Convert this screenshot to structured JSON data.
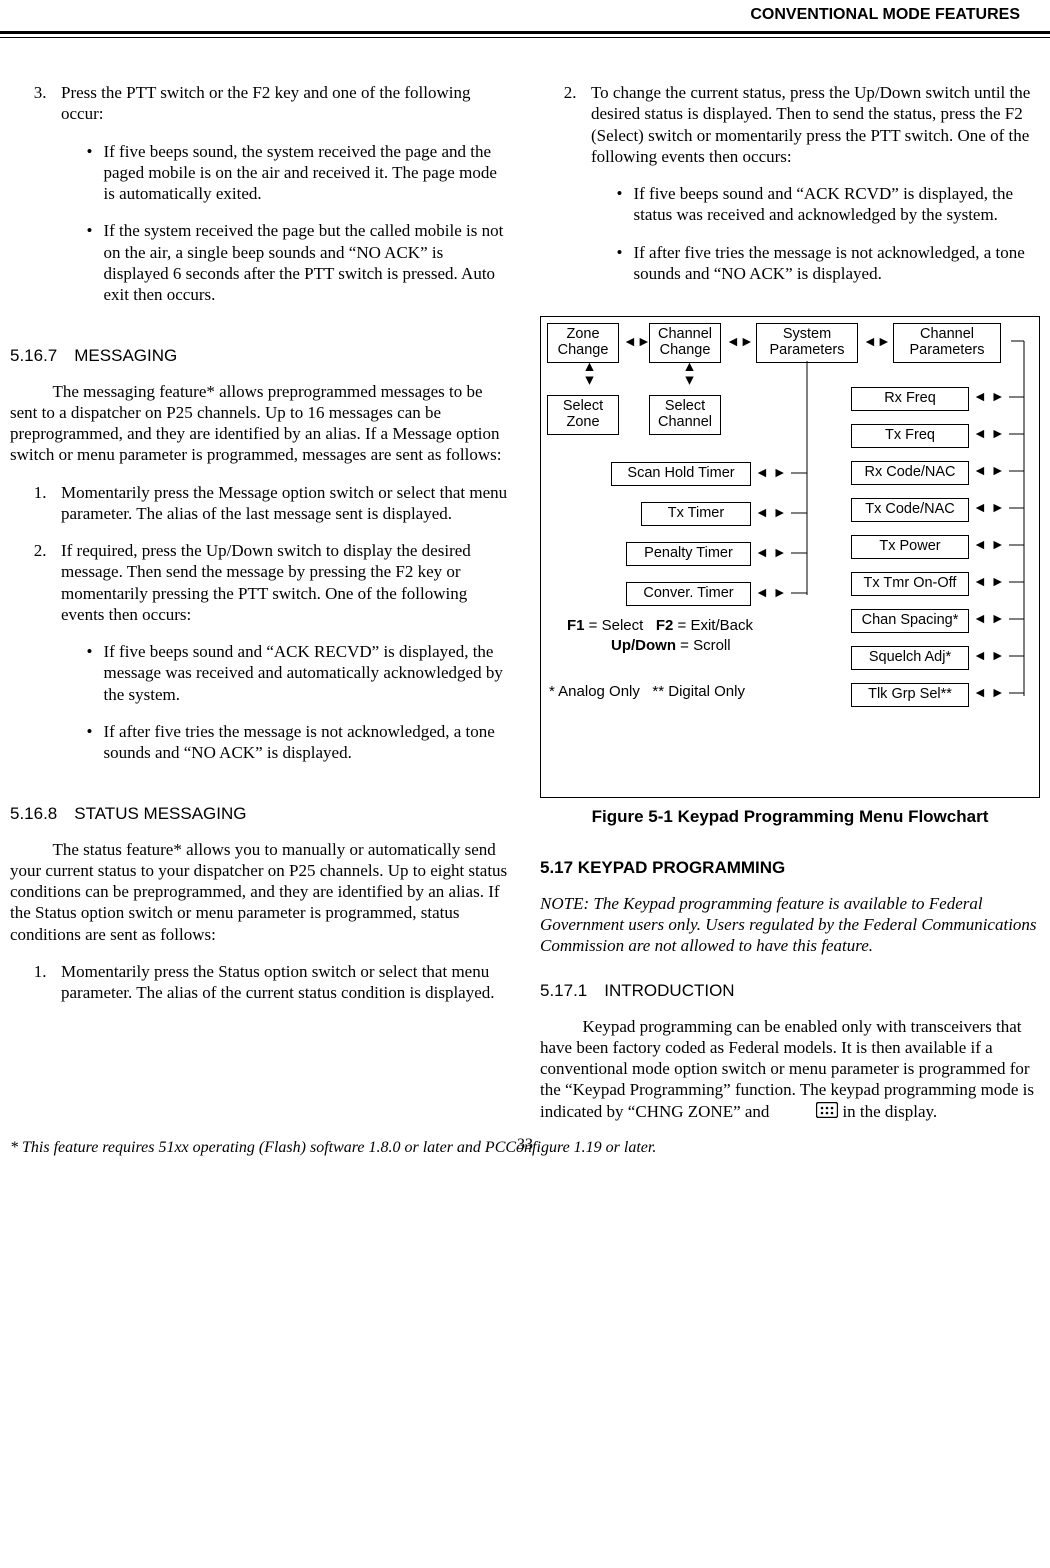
{
  "header": {
    "title": "CONVENTIONAL MODE FEATURES"
  },
  "left": {
    "step3_intro": "Press the PTT switch or the F2 key and one of the following occur:",
    "step3_b1": "If five beeps sound, the system received the page and the paged mobile is on the air and received it. The page mode is automatically exited.",
    "step3_b2": "If the system received the page but the called mobile is not on the air, a single beep sounds and “NO ACK” is displayed 6 seconds after the PTT switch is pressed. Auto exit then occurs.",
    "h_5_16_7": "5.16.7 MESSAGING",
    "p_msg_intro": "The messaging feature* allows preprogrammed messages to be sent to a dispatcher on P25 channels. Up to 16 messages can be preprogrammed, and they are identified by an alias. If a Message option switch or menu parameter is programmed, messages are sent as follows:",
    "msg_s1": "Momentarily press the Message option switch or select that menu parameter. The alias of the last message sent is displayed.",
    "msg_s2": "If required, press the Up/Down switch to display the desired message. Then send the message by pressing the F2 key or momentarily pressing the PTT switch. One of the following events then occurs:",
    "msg_s2_b1": "If five beeps sound and “ACK RECVD” is displayed, the message was received and automatically acknowledged by the system.",
    "msg_s2_b2": "If after five tries the message is not acknowledged, a tone sounds and “NO ACK” is displayed.",
    "h_5_16_8": "5.16.8 STATUS MESSAGING",
    "p_stat_intro": "The status feature* allows you to manually or automatically send your current status to your dispatcher on P25 channels. Up to eight status conditions can be preprogrammed, and they are identified by an alias. If the Status option switch or menu parameter is programmed, status conditions are sent as follows:",
    "stat_s1": "Momentarily press the Status option switch or select that menu parameter. The alias of the current status condition is displayed."
  },
  "right": {
    "stat_s2": "To change the current status, press the Up/Down switch until the desired status is displayed. Then to send the status, press the F2 (Select) switch or momentarily press the PTT switch. One of the following events then occurs:",
    "stat_s2_b1": "If five beeps sound and “ACK RCVD” is displayed, the status was received and acknowledged by the system.",
    "stat_s2_b2": "If after five tries the message is not acknowledged, a tone sounds and “NO ACK” is displayed.",
    "figcap": "Figure 5-1   Keypad Programming Menu Flowchart",
    "h_5_17": "5.17 KEYPAD PROGRAMMING",
    "note": "NOTE: The Keypad programming feature is available to Federal Government users only. Users regulated by the Federal Communications Commission are not allowed to have this feature.",
    "h_5_17_1": "5.17.1 INTRODUCTION",
    "p_intro_1a": "Keypad programming can be enabled only with transceivers that have been factory coded as Federal models. It is then available if a conventional mode option switch or menu parameter is programmed for the “Keypad Programming” function. The keypad programming mode is indicated by “CHNG ZONE” and ",
    "p_intro_1b": " in the display."
  },
  "flow": {
    "zone_change": "Zone\nChange",
    "channel_change": "Channel\nChange",
    "system_params": "System\nParameters",
    "channel_params": "Channel\nParameters",
    "select_zone": "Select\nZone",
    "select_channel": "Select\nChannel",
    "scan_hold": "Scan Hold Timer",
    "tx_timer": "Tx Timer",
    "penalty_timer": "Penalty Timer",
    "conver_timer": "Conver. Timer",
    "rx_freq": "Rx Freq",
    "tx_freq": "Tx Freq",
    "rx_code": "Rx Code/NAC",
    "tx_code": "Tx Code/NAC",
    "tx_power": "Tx Power",
    "tx_tmr": "Tx Tmr On-Off",
    "chan_spacing": "Chan Spacing*",
    "squelch": "Squelch Adj*",
    "tlk_grp": "Tlk Grp Sel**",
    "legend_f1": "F1",
    "legend_f1t": " = Select",
    "legend_f2": "F2",
    "legend_f2t": " = Exit/Back",
    "legend_ud": "Up/Down",
    "legend_udt": " = Scroll",
    "legend_a": "* Analog Only",
    "legend_d": "** Digital Only"
  },
  "footnote": "* This feature requires 51xx operating (Flash) software 1.8.0 or later and PCConfigure 1.19 or later.",
  "pagenum": "33"
}
